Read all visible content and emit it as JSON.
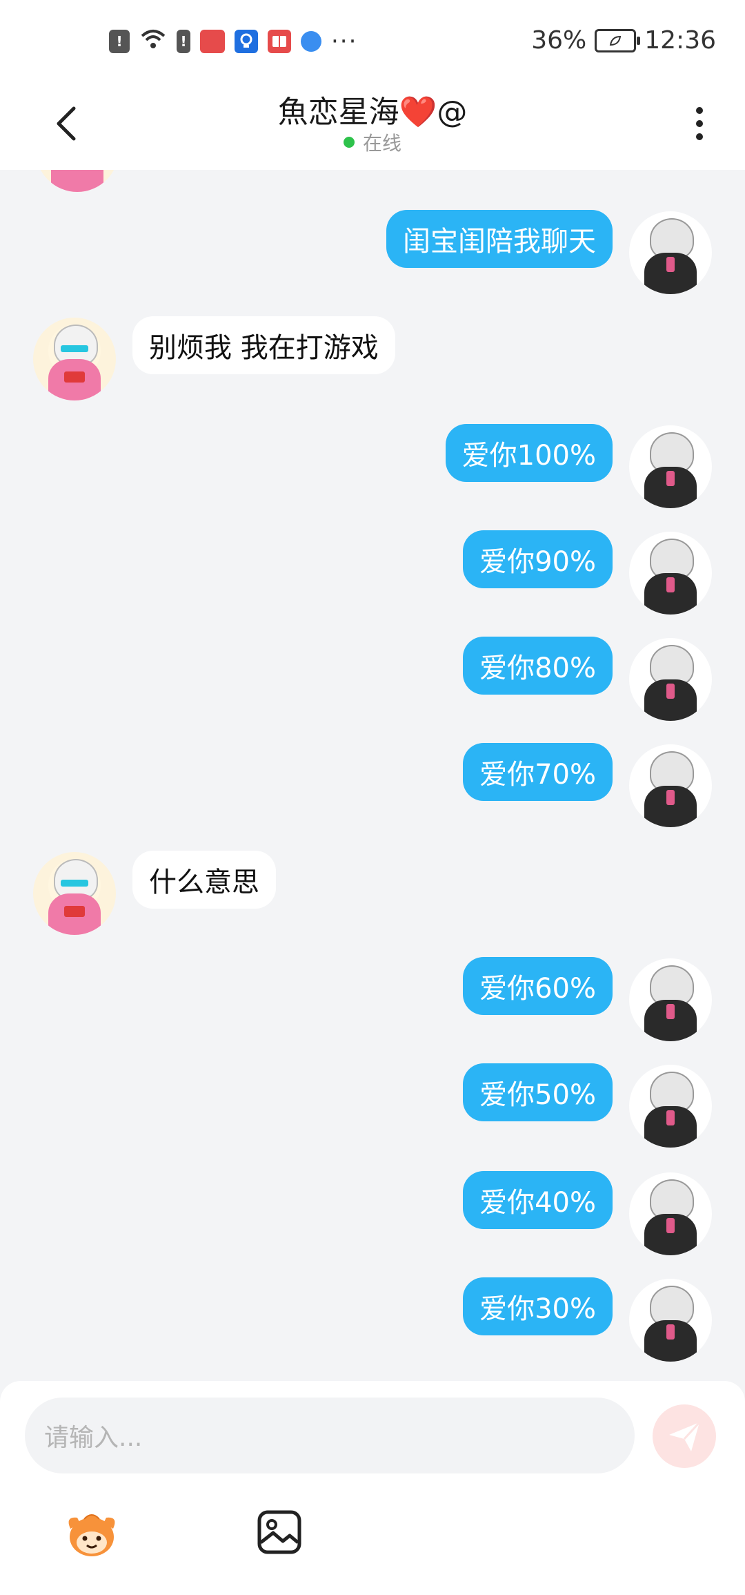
{
  "status_bar": {
    "battery": "36%",
    "time": "12:36"
  },
  "header": {
    "title": "魚恋星海❤️@",
    "status": "在线"
  },
  "messages": [
    {
      "from": "self",
      "text": "闺宝闺陪我聊天"
    },
    {
      "from": "other",
      "text": "别烦我 我在打游戏"
    },
    {
      "from": "self",
      "text": "爱你100%"
    },
    {
      "from": "self",
      "text": "爱你90%"
    },
    {
      "from": "self",
      "text": "爱你80%"
    },
    {
      "from": "self",
      "text": "爱你70%"
    },
    {
      "from": "other",
      "text": "什么意思"
    },
    {
      "from": "self",
      "text": "爱你60%"
    },
    {
      "from": "self",
      "text": "爱你50%"
    },
    {
      "from": "self",
      "text": "爱你40%"
    },
    {
      "from": "self",
      "text": "爱你30%"
    }
  ],
  "input": {
    "placeholder": "请输入..."
  },
  "icons": {
    "back": "chevron-left-icon",
    "more": "more-vertical-icon",
    "send": "send-icon",
    "emoji": "emoji-mascot-icon",
    "image": "image-icon"
  },
  "colors": {
    "self_bubble": "#2bb4f5",
    "other_bubble": "#ffffff",
    "background": "#f3f4f6",
    "online_dot": "#2ec24b",
    "send_button": "#fde3e2"
  }
}
